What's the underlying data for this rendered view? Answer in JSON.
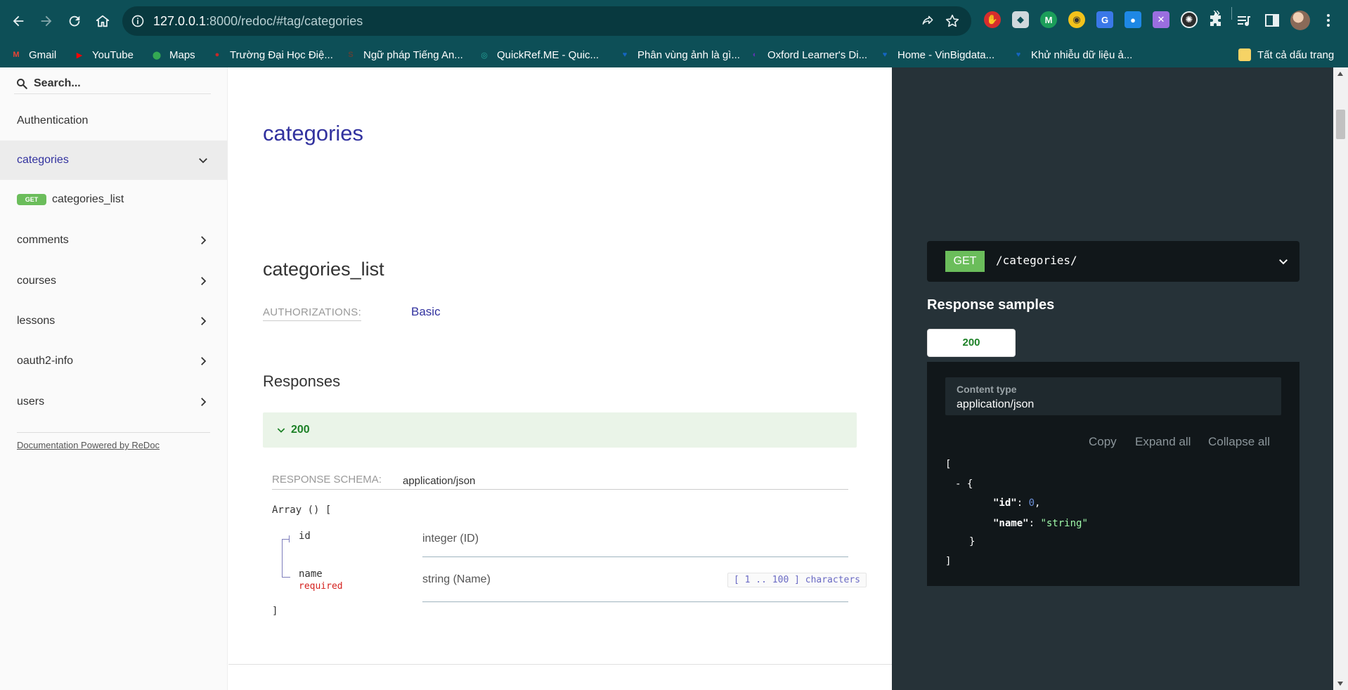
{
  "browser": {
    "url": {
      "host": "127.0.0.1",
      "path": ":8000/redoc/#tag/categories"
    },
    "bookmarks": [
      {
        "label": "Gmail",
        "icon": "gmail-icon",
        "color": "#ea4335"
      },
      {
        "label": "YouTube",
        "icon": "youtube-icon",
        "color": "#ff0000"
      },
      {
        "label": "Maps",
        "icon": "maps-icon",
        "color": "#34a853"
      },
      {
        "label": "Trường Đại Học Điệ...",
        "icon": "university-icon",
        "color": "#c62828"
      },
      {
        "label": "Ngữ pháp Tiếng An...",
        "icon": "grammar-icon",
        "color": "#5d4037"
      },
      {
        "label": "QuickRef.ME - Quic...",
        "icon": "quickref-icon",
        "color": "#26a69a"
      },
      {
        "label": "Phân vùng ảnh là gì...",
        "icon": "viblo-icon",
        "color": "#1565c0"
      },
      {
        "label": "Oxford Learner's Di...",
        "icon": "oxford-icon",
        "color": "#5e35b1"
      },
      {
        "label": "Home - VinBigdata...",
        "icon": "vinbigdata-icon",
        "color": "#1565c0"
      },
      {
        "label": "Khử nhiễu dữ liệu ả...",
        "icon": "viblo-icon",
        "color": "#1565c0"
      }
    ],
    "more_bookmarks": "»",
    "all_bookmarks": "Tất cả dấu trang"
  },
  "sidebar": {
    "search_placeholder": "Search...",
    "items": [
      {
        "label": "Authentication"
      },
      {
        "label": "categories"
      },
      {
        "label": "comments"
      },
      {
        "label": "courses"
      },
      {
        "label": "lessons"
      },
      {
        "label": "oauth2-info"
      },
      {
        "label": "users"
      }
    ],
    "operation": {
      "method": "get",
      "label": "categories_list"
    },
    "powered_by": "Documentation Powered by ReDoc"
  },
  "content": {
    "tag_title": "categories",
    "operation_title": "categories_list",
    "authorizations_label": "Authorizations:",
    "authorizations_value": "Basic",
    "responses_title": "Responses",
    "response_code": "200",
    "schema_label": "Response Schema:",
    "schema_type": "application/json",
    "array_open": "Array () [",
    "array_close": "]",
    "properties": [
      {
        "name": "id",
        "type": "integer (ID)",
        "required": ""
      },
      {
        "name": "name",
        "type": "string (Name)",
        "required": "required",
        "constraint": "[ 1 .. 100 ] characters"
      }
    ]
  },
  "right_panel": {
    "method": "GET",
    "path": "/categories/",
    "samples_title": "Response samples",
    "status_tab": "200",
    "content_type_label": "Content type",
    "content_type_value": "application/json",
    "actions": {
      "copy": "Copy",
      "expand": "Expand all",
      "collapse": "Collapse all"
    },
    "json_sample": {
      "open": "[",
      "item_open": "- {",
      "id_key": "\"id\"",
      "id_value": "0",
      "name_key": "\"name\"",
      "name_value": "\"string\"",
      "item_close": "}",
      "close": "]"
    }
  },
  "colors": {
    "accent": "#32329f",
    "get_badge": "#6bbd5b",
    "success": "#1d8127",
    "required": "#d41f1c",
    "chrome": "#0d4f57",
    "right_panel": "#263238"
  }
}
